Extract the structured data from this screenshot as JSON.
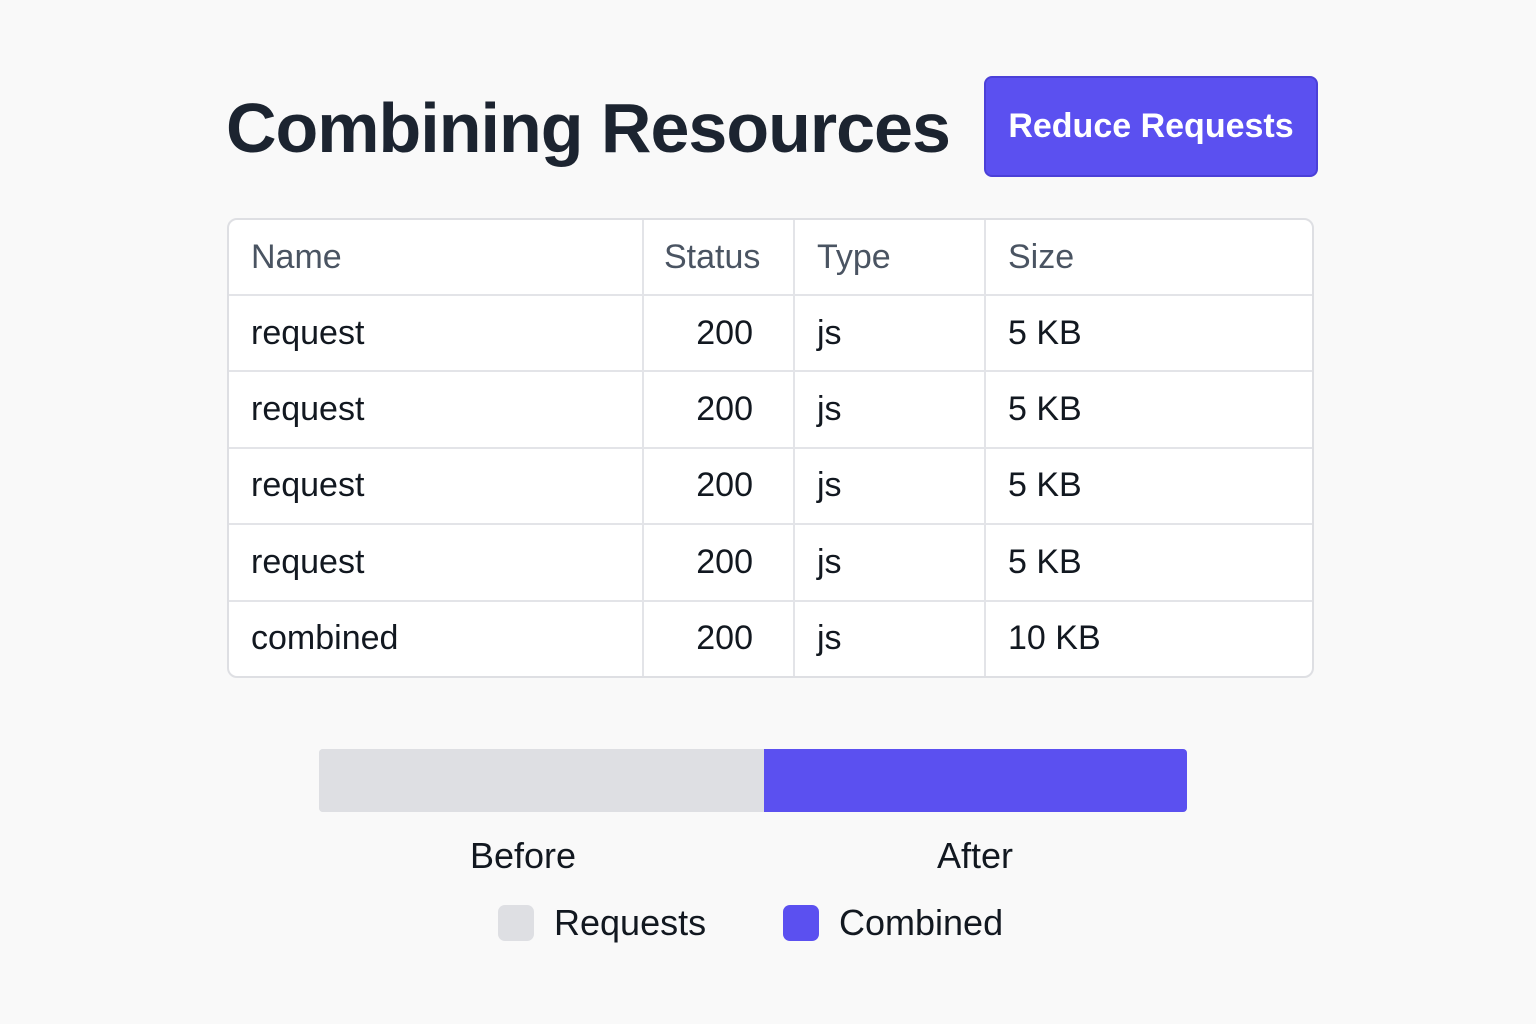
{
  "header": {
    "title": "Combining Resources",
    "action_label": "Reduce Requests"
  },
  "table": {
    "columns": [
      "Name",
      "Status",
      "Type",
      "Size"
    ],
    "rows": [
      [
        "request",
        "200",
        "js",
        "5 KB"
      ],
      [
        "request",
        "200",
        "js",
        "5 KB"
      ],
      [
        "request",
        "200",
        "js",
        "5 KB"
      ],
      [
        "request",
        "200",
        "js",
        "5 KB"
      ],
      [
        "combined",
        "200",
        "js",
        "10 KB"
      ]
    ]
  },
  "comparison": {
    "before_label": "Before",
    "after_label": "After",
    "before_fraction": 0.513,
    "after_fraction": 0.487
  },
  "legend": {
    "requests_label": "Requests",
    "combined_label": "Combined"
  },
  "colors": {
    "accent": "#5b50f0",
    "requests": "#dedfe3",
    "title": "#1c2430"
  }
}
